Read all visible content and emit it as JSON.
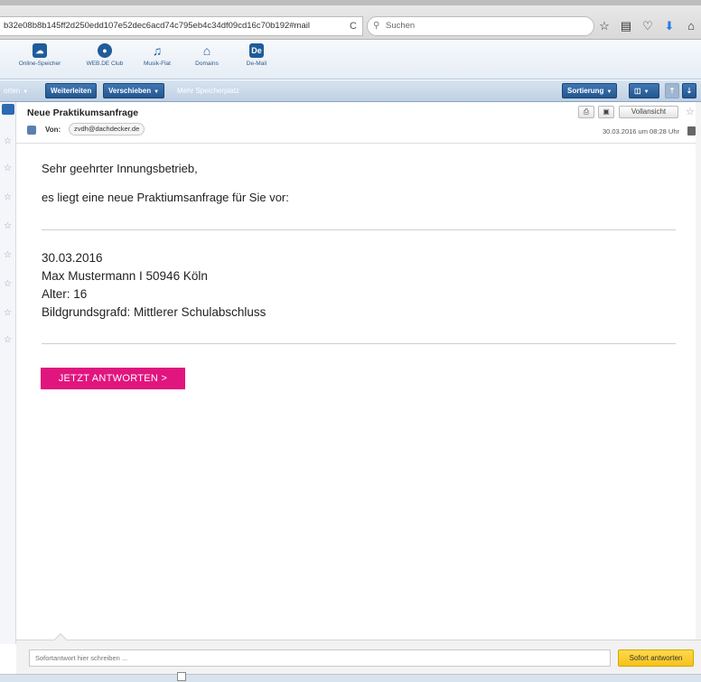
{
  "browser": {
    "url": "b32e08b8b145ff2d250edd107e52dec6acd74c795eb4c34df09cd16c70b192#mail",
    "reload_icon": "reload-icon",
    "search_placeholder": "Suchen",
    "icons": [
      "star-icon",
      "bookmarks-icon",
      "pocket-icon",
      "download-icon",
      "home-icon"
    ]
  },
  "apps": [
    {
      "label": "Online-Speicher",
      "icon": "cloud-icon"
    },
    {
      "label": "WEB.DE Club",
      "icon": "club-icon"
    },
    {
      "label": "Musik-Flat",
      "icon": "music-icon"
    },
    {
      "label": "Domains",
      "icon": "house-icon"
    },
    {
      "label": "De-Mail",
      "icon": "de-mail-icon"
    }
  ],
  "toolbar": {
    "reply_label": "orten",
    "forward_label": "Weiterleiten",
    "move_label": "Verschieben",
    "storage_link": "Mehr Speicherplatz",
    "sort_label": "Sortierung"
  },
  "mail": {
    "subject": "Neue Praktikumsanfrage",
    "from_label": "Von:",
    "from_address": "zvdh@dachdecker.de",
    "fullview_label": "Vollansicht",
    "date": "30.03.2016 um 08:28 Uhr",
    "greeting": "Sehr geehrter Innungsbetrieb,",
    "intro": "es liegt eine neue Praktiumsanfrage für Sie vor:",
    "details": [
      "30.03.2016",
      "Max Mustermann I 50946 Köln",
      "Alter: 16",
      "Bildgrundsgrafd: Mittlerer Schulabschluss"
    ],
    "cta_label": "JETZT ANTWORTEN >"
  },
  "reply": {
    "placeholder": "Sofortantwort hier schreiben ...",
    "button_label": "Sofort antworten"
  },
  "colors": {
    "accent": "#e1157e",
    "toolbar_blue": "#24568f",
    "reply_yellow": "#f5c21b"
  }
}
